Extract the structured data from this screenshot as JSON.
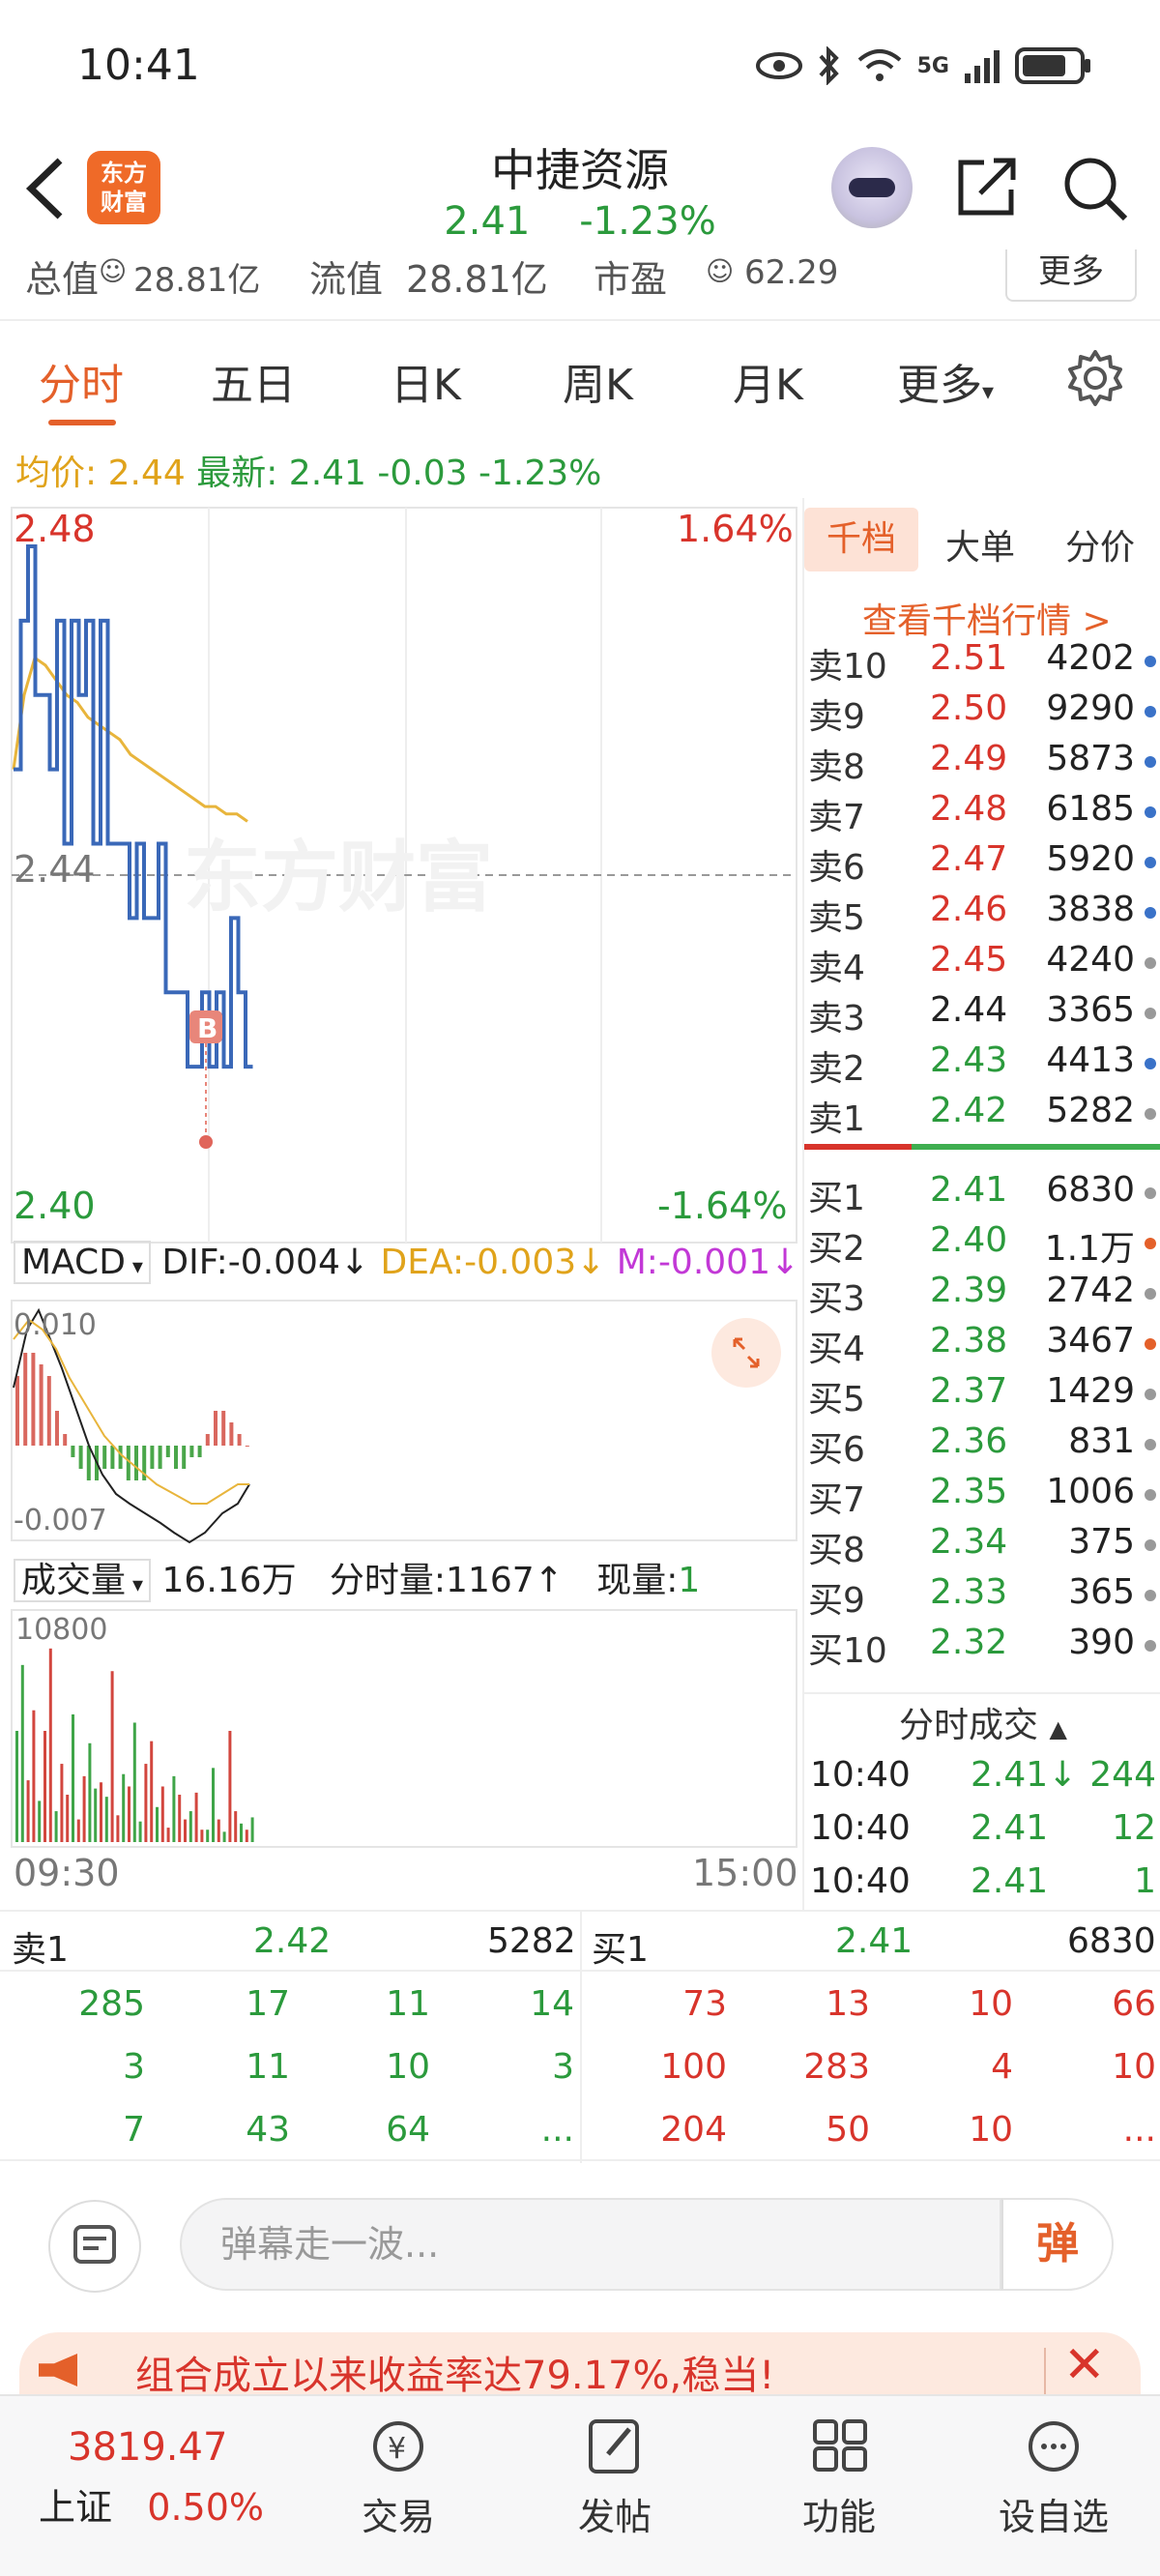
{
  "status_bar": {
    "time": "10:41",
    "icons": [
      "eye-icon",
      "bluetooth-icon",
      "wifi-icon",
      "5g-signal-icon",
      "battery-icon"
    ],
    "network": "5G"
  },
  "header": {
    "logo_line1": "东方",
    "logo_line2": "财富",
    "name": "中捷资源",
    "price": "2.41",
    "change_pct": "-1.23%"
  },
  "metrics": {
    "mkt_cap_label": "总值",
    "mkt_cap": "28.81亿",
    "float_label": "流值",
    "float_cap": "28.81亿",
    "pe_label": "市盈",
    "pe": "62.29",
    "more_label": "更多"
  },
  "tabs": [
    "分时",
    "五日",
    "日K",
    "周K",
    "月K",
    "更多"
  ],
  "info_line": {
    "avg_label": "均价:",
    "avg": "2.44",
    "latest_label": "最新:",
    "latest": "2.41",
    "change": "-0.03",
    "change_pct": "-1.23%"
  },
  "price_chart": {
    "y_high": "2.48",
    "y_mid": "2.44",
    "y_low": "2.40",
    "pct_high": "1.64%",
    "pct_low": "-1.64%",
    "watermark": "东方财富",
    "marker": "B",
    "time_start": "09:30",
    "time_end": "15:00"
  },
  "macd": {
    "label": "MACD",
    "dif": "DIF:-0.004",
    "dea": "DEA:-0.003",
    "m": "M:-0.001",
    "top": "0.010",
    "bottom": "-0.007"
  },
  "volume": {
    "label": "成交量",
    "total": "16.16万",
    "tick_vol": "分时量:1167",
    "cur_label": "现量:",
    "cur": "1",
    "top": "10800"
  },
  "chart_data": [
    {
      "type": "line",
      "title": "",
      "x_range": [
        "09:30",
        "15:00"
      ],
      "ylim": [
        2.4,
        2.48
      ],
      "series": [
        {
          "values": [
            2.45,
            2.47,
            2.48,
            2.46,
            2.46,
            2.45,
            2.47,
            2.44,
            2.47,
            2.46,
            2.47,
            2.44,
            2.47,
            2.44,
            2.44,
            2.44,
            2.43,
            2.44,
            2.43,
            2.43,
            2.44,
            2.42,
            2.42,
            2.42,
            2.41,
            2.41,
            2.42,
            2.41,
            2.42,
            2.41,
            2.43,
            2.42,
            2.41,
            2.41
          ]
        },
        {
          "values": [
            2.45,
            2.46,
            2.465,
            2.464,
            2.462,
            2.46,
            2.459,
            2.457,
            2.456,
            2.455,
            2.454,
            2.452,
            2.451,
            2.45,
            2.449,
            2.448,
            2.447,
            2.446,
            2.445,
            2.445,
            2.444,
            2.444,
            2.443
          ]
        }
      ]
    },
    {
      "type": "bar",
      "title": "",
      "ylim": [
        -0.007,
        0.01
      ],
      "values": [
        0.006,
        0.008,
        0.008,
        0.007,
        0.006,
        0.003,
        0.001,
        -0.001,
        -0.002,
        -0.003,
        -0.003,
        -0.002,
        -0.002,
        -0.002,
        -0.003,
        -0.003,
        -0.003,
        -0.002,
        -0.002,
        -0.001,
        -0.002,
        -0.002,
        -0.001,
        -0.001,
        0.001,
        0.003,
        0.003,
        0.002,
        0.001,
        0.0
      ]
    },
    {
      "type": "bar",
      "title": "",
      "ylim": [
        0,
        10800
      ],
      "values": [
        5400,
        8600,
        3000,
        6400,
        2000,
        5400,
        9400,
        1500,
        3800,
        2300,
        6200,
        1100,
        3200,
        4800,
        2600,
        2900,
        2200,
        8300,
        1300,
        3300,
        2700,
        5800,
        1000,
        3800,
        4900,
        1700,
        2700,
        700,
        3200,
        2300,
        1100,
        1500,
        2400,
        600,
        600,
        3600,
        1100,
        500,
        5400,
        1500,
        900,
        600,
        1200
      ]
    }
  ],
  "right_panel": {
    "tabs": [
      "千档",
      "大单",
      "分价"
    ],
    "level_link": "查看千档行情 >",
    "asks": [
      {
        "label": "卖10",
        "price": "2.51",
        "vol": "4202",
        "dot": "blue"
      },
      {
        "label": "卖9",
        "price": "2.50",
        "vol": "9290",
        "dot": "blue"
      },
      {
        "label": "卖8",
        "price": "2.49",
        "vol": "5873",
        "dot": "blue"
      },
      {
        "label": "卖7",
        "price": "2.48",
        "vol": "6185",
        "dot": "blue"
      },
      {
        "label": "卖6",
        "price": "2.47",
        "vol": "5920",
        "dot": "blue"
      },
      {
        "label": "卖5",
        "price": "2.46",
        "vol": "3838",
        "dot": "blue"
      },
      {
        "label": "卖4",
        "price": "2.45",
        "vol": "4240",
        "dot": "grey"
      },
      {
        "label": "卖3",
        "price": "2.44",
        "vol": "3365",
        "dot": "grey"
      },
      {
        "label": "卖2",
        "price": "2.43",
        "vol": "4413",
        "dot": "blue"
      },
      {
        "label": "卖1",
        "price": "2.42",
        "vol": "5282",
        "dot": "grey"
      }
    ],
    "bids": [
      {
        "label": "买1",
        "price": "2.41",
        "vol": "6830",
        "dot": "grey"
      },
      {
        "label": "买2",
        "price": "2.40",
        "vol": "1.1万",
        "dot": "orange"
      },
      {
        "label": "买3",
        "price": "2.39",
        "vol": "2742",
        "dot": "grey"
      },
      {
        "label": "买4",
        "price": "2.38",
        "vol": "3467",
        "dot": "orange"
      },
      {
        "label": "买5",
        "price": "2.37",
        "vol": "1429",
        "dot": "grey"
      },
      {
        "label": "买6",
        "price": "2.36",
        "vol": "831",
        "dot": "grey"
      },
      {
        "label": "买7",
        "price": "2.35",
        "vol": "1006",
        "dot": "grey"
      },
      {
        "label": "买8",
        "price": "2.34",
        "vol": "375",
        "dot": "grey"
      },
      {
        "label": "买9",
        "price": "2.33",
        "vol": "365",
        "dot": "grey"
      },
      {
        "label": "买10",
        "price": "2.32",
        "vol": "390",
        "dot": "grey"
      }
    ],
    "ticks_title": "分时成交",
    "ticks": [
      {
        "time": "10:40",
        "price": "2.41↓",
        "vol": "244"
      },
      {
        "time": "10:40",
        "price": "2.41",
        "vol": "12"
      },
      {
        "time": "10:40",
        "price": "2.41",
        "vol": "1"
      }
    ]
  },
  "queue": {
    "sell_label": "卖1",
    "sell_price": "2.42",
    "sell_vol": "5282",
    "buy_label": "买1",
    "buy_price": "2.41",
    "buy_vol": "6830",
    "sell_rows": [
      [
        "285",
        "17",
        "11",
        "14"
      ],
      [
        "3",
        "11",
        "10",
        "3"
      ],
      [
        "7",
        "43",
        "64",
        "..."
      ]
    ],
    "buy_rows": [
      [
        "73",
        "13",
        "10",
        "66"
      ],
      [
        "100",
        "283",
        "4",
        "10"
      ],
      [
        "204",
        "50",
        "10",
        "..."
      ]
    ]
  },
  "comment": {
    "placeholder": "弹幕走一波...",
    "send": "弹"
  },
  "promo": {
    "text": "组合成立以来收益率达79.17%,稳当!"
  },
  "bottom_nav": {
    "index_value": "3819.47",
    "index_name": "上证",
    "index_change": "0.50%",
    "items": [
      "交易",
      "发帖",
      "功能",
      "设自选"
    ]
  }
}
